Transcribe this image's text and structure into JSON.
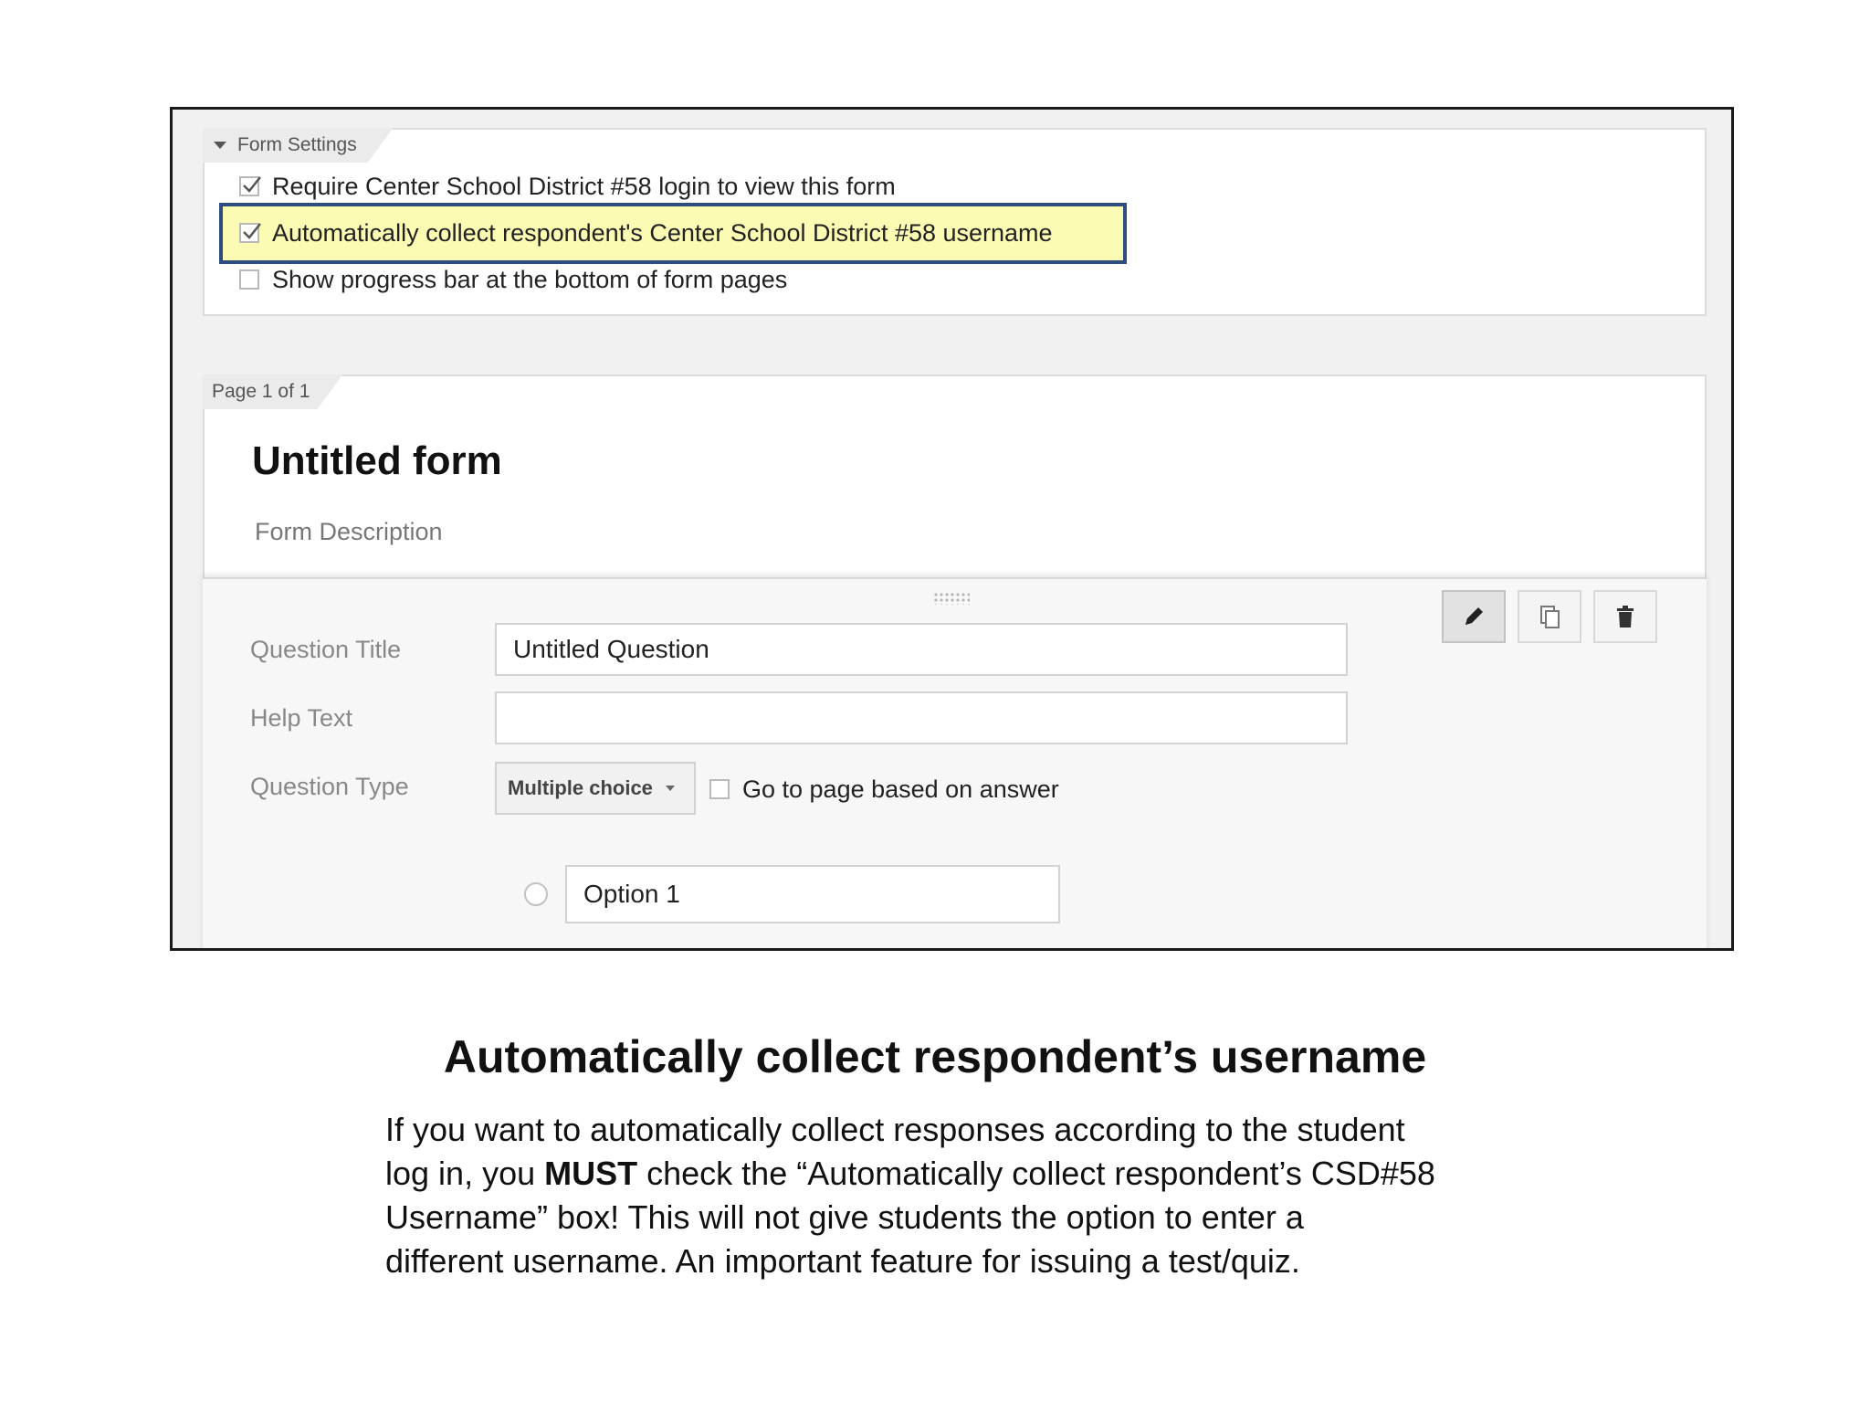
{
  "settings": {
    "header": "Form Settings",
    "options": [
      {
        "label": "Require Center School District #58 login to view this form",
        "checked": true
      },
      {
        "label": "Automatically collect respondent's Center School District #58 username",
        "checked": true,
        "highlighted": true
      },
      {
        "label": "Show progress bar at the bottom of form pages",
        "checked": false
      }
    ]
  },
  "page": {
    "indicator": "Page 1 of 1",
    "title": "Untitled form",
    "description": "Form Description"
  },
  "question": {
    "title_label": "Question Title",
    "title_value": "Untitled Question",
    "help_label": "Help Text",
    "help_value": "",
    "type_label": "Question Type",
    "type_value": "Multiple choice",
    "goto_label": "Go to page based on answer",
    "goto_checked": false,
    "option_1": "Option 1",
    "tools": [
      "pencil-icon",
      "duplicate-icon",
      "trash-icon"
    ]
  },
  "caption": {
    "title": "Automatically collect respondent’s username",
    "line1": "If you want to automatically collect responses according to the student",
    "line2_pre": "log in, you ",
    "line2_bold": "MUST",
    "line2_post": " check the “Automatically collect respondent’s CSD#58",
    "line3": "Username” box!  This will not give students the option to enter a",
    "line4": "different username.  An important feature for issuing a test/quiz."
  },
  "colors": {
    "highlight_fill": "#fbfbb4",
    "highlight_border": "#2e4d7e"
  }
}
